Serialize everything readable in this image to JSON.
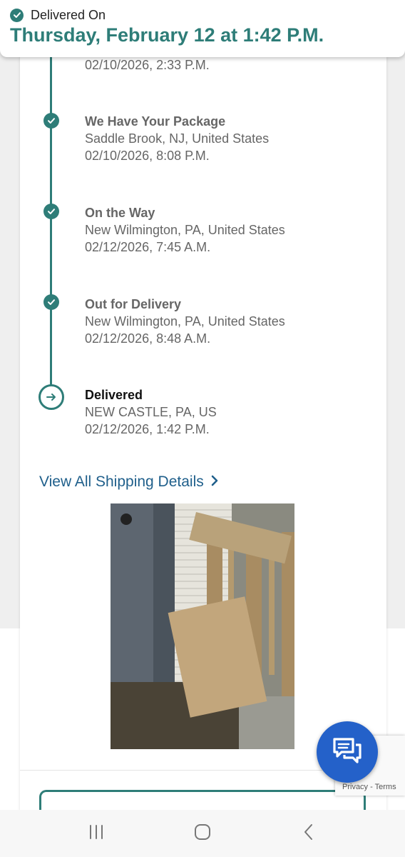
{
  "header": {
    "status": "Delivered On",
    "date": "Thursday, February 12 at 1:42 P.M."
  },
  "timeline": {
    "partial_date": "02/10/2026, 2:33 P.M.",
    "events": [
      {
        "title": "We Have Your Package",
        "location": "Saddle Brook, NJ, United States",
        "date": "02/10/2026, 8:08 P.M."
      },
      {
        "title": "On the Way",
        "location": "New Wilmington, PA, United States",
        "date": "02/12/2026, 7:45 A.M."
      },
      {
        "title": "Out for Delivery",
        "location": "New Wilmington, PA, United States",
        "date": "02/12/2026, 8:48 A.M."
      },
      {
        "title": "Delivered",
        "location": "NEW CASTLE, PA, US",
        "date": "02/12/2026, 1:42 P.M."
      }
    ]
  },
  "link": {
    "view_all": "View All Shipping Details"
  },
  "recaptcha": {
    "links": "Privacy - Terms"
  },
  "icons": {
    "check": "check-icon",
    "arrow": "arrow-right-icon",
    "chevron": "chevron-right-icon",
    "chat": "chat-icon",
    "nav_recents": "recents-icon",
    "nav_home": "home-icon",
    "nav_back": "back-icon"
  },
  "colors": {
    "accent": "#2e7d78",
    "link": "#1f5f8b",
    "chat": "#2461c9"
  }
}
